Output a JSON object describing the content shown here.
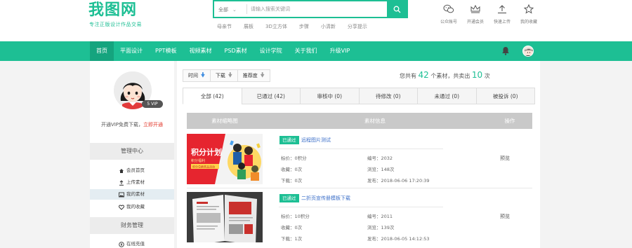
{
  "brand": {
    "logo": "我图网",
    "slogan": "专注正版设计作品交易",
    "accent": "#1dbf94"
  },
  "search": {
    "category": "全部",
    "placeholder": "请输入搜索关键词",
    "hot_tags": [
      "母亲节",
      "展板",
      "3D立方体",
      "步骤",
      "小清新",
      "分享提示"
    ]
  },
  "user_menu": [
    {
      "icon": "wechat-icon",
      "label": "公众账号"
    },
    {
      "icon": "crown-icon",
      "label": "开通会员"
    },
    {
      "icon": "upload-icon",
      "label": "快速上传"
    },
    {
      "icon": "star-icon",
      "label": "我的收藏"
    }
  ],
  "nav": {
    "items": [
      "首页",
      "平面设计",
      "PPT模板",
      "视频素材",
      "PSD素材",
      "设计学院",
      "关于我们",
      "升级VIP"
    ],
    "active_index": 0
  },
  "sidebar": {
    "level_badge": "5 VIP",
    "vip_tip_prefix": "开通VIP免费下载，",
    "vip_tip_link": "立即开通",
    "sections": [
      {
        "title": "管理中心",
        "items": [
          {
            "icon": "home-icon",
            "label": "会员首页"
          },
          {
            "icon": "upload-icon",
            "label": "上传素材"
          },
          {
            "icon": "image-icon",
            "label": "我的素材",
            "active": true
          },
          {
            "icon": "heart-icon",
            "label": "我的收藏"
          }
        ]
      },
      {
        "title": "财务管理",
        "items": [
          {
            "icon": "coin-icon",
            "label": "在线充值"
          }
        ]
      }
    ]
  },
  "sort": [
    {
      "label": "时间",
      "arrow": "blue"
    },
    {
      "label": "下载",
      "arrow": "gray"
    },
    {
      "label": "推荐度",
      "arrow": "gray"
    }
  ],
  "stats": {
    "prefix": "您共有",
    "total": "42",
    "mid": "个素材，共卖出",
    "sold": "10",
    "suffix": "次"
  },
  "tabs": [
    "全部 (42)",
    "已通过 (42)",
    "审核中 (0)",
    "待修改 (0)",
    "未通过 (0)",
    "被投诉 (0)"
  ],
  "table": {
    "headers": [
      "素材缩略图",
      "素材信息",
      "操作"
    ],
    "rows": [
      {
        "status": "已通过",
        "title": "远程图片测试",
        "price": "标价：0积分",
        "id": "编号：2032",
        "fav": "收藏：0次",
        "views": "浏览：148次",
        "downloads": "下载：0次",
        "published": "发布：2018-06-06 17:20:39",
        "action": "预览",
        "thumb_theme": "red"
      },
      {
        "status": "已通过",
        "title": "二折页宣传册模板下载",
        "price": "标价：10积分",
        "id": "编号：2011",
        "fav": "收藏：0次",
        "views": "浏览：139次",
        "downloads": "下载：1次",
        "published": "发布：2018-06-05 14:12:53",
        "action": "预览",
        "thumb_theme": "brochure"
      }
    ]
  },
  "thumb1": {
    "title": "积分计划",
    "subtitle": "积分福利",
    "banner": "积分兑换奖品活动"
  }
}
